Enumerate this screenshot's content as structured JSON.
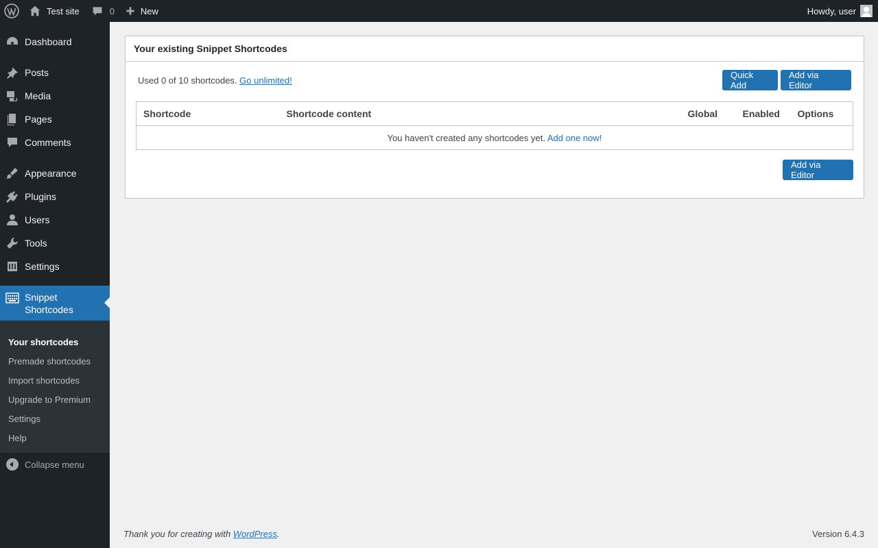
{
  "adminbar": {
    "site_name": "Test site",
    "comments_count": "0",
    "new_label": "New",
    "howdy": "Howdy, user"
  },
  "sidebar": {
    "items": [
      {
        "label": "Dashboard",
        "icon": "dashboard-icon"
      },
      {
        "label": "Posts",
        "icon": "pin-icon"
      },
      {
        "label": "Media",
        "icon": "media-icon"
      },
      {
        "label": "Pages",
        "icon": "pages-icon"
      },
      {
        "label": "Comments",
        "icon": "comment-icon"
      },
      {
        "label": "Appearance",
        "icon": "brush-icon"
      },
      {
        "label": "Plugins",
        "icon": "plug-icon"
      },
      {
        "label": "Users",
        "icon": "user-icon"
      },
      {
        "label": "Tools",
        "icon": "wrench-icon"
      },
      {
        "label": "Settings",
        "icon": "settings-icon"
      }
    ],
    "current": {
      "label_line1": "Snippet",
      "label_line2": "Shortcodes",
      "icon": "keyboard-icon"
    },
    "submenu": [
      "Your shortcodes",
      "Premade shortcodes",
      "Import shortcodes",
      "Upgrade to Premium",
      "Settings",
      "Help"
    ],
    "collapse": "Collapse menu"
  },
  "panel": {
    "title": "Your existing Snippet Shortcodes",
    "usage_text": "Used 0 of 10 shortcodes.",
    "usage_link": "Go unlimited!",
    "quick_add": "Quick Add",
    "add_via_editor": "Add via Editor",
    "table": {
      "headers": [
        "Shortcode",
        "Shortcode content",
        "Global",
        "Enabled",
        "Options"
      ],
      "empty_text": "You haven't created any shortcodes yet.",
      "empty_link": "Add one now!"
    },
    "add_via_editor_bottom": "Add via Editor"
  },
  "footer": {
    "thanks_prefix": "Thank you for creating with",
    "wordpress_link": "WordPress",
    "thanks_suffix": ".",
    "version": "Version 6.4.3"
  }
}
